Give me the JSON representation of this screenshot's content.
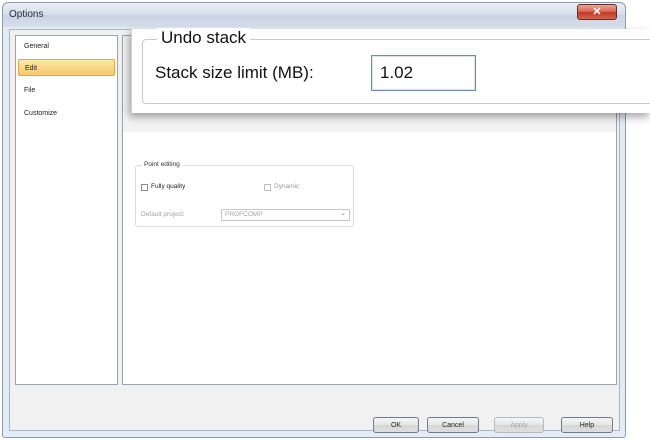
{
  "window": {
    "title": "Options",
    "close_glyph": "✕"
  },
  "sidebar": {
    "items": [
      {
        "label": "General",
        "selected": false
      },
      {
        "label": "Edit",
        "selected": true
      },
      {
        "label": "File",
        "selected": false
      },
      {
        "label": "Customize",
        "selected": false
      }
    ]
  },
  "undo": {
    "legend": "Undo stack",
    "stack_label": "Stack size limit (MB):",
    "stack_value": "1.02"
  },
  "point_editing": {
    "legend": "Point editing",
    "fully_quality_label": "Fully quality",
    "fully_quality_checked": false,
    "dynamic_label": "Dynamic",
    "dynamic_checked": false,
    "dynamic_enabled": false,
    "default_project_label": "Default project:",
    "default_project_value": "PROFCOMP"
  },
  "buttons": {
    "ok": "OK",
    "cancel": "Cancel",
    "apply": "Apply",
    "help": "Help"
  },
  "icons": {
    "dropdown": "chevron-down-icon",
    "close": "close-icon"
  }
}
